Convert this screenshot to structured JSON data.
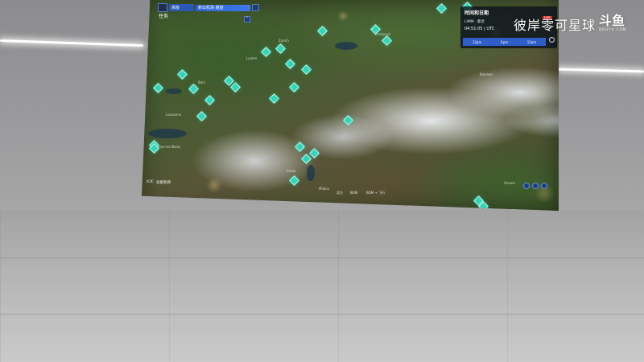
{
  "map": {
    "top_category": "高级",
    "top_bar_label": "新出机场 跑道",
    "mission_label": "任务",
    "chevron_glyph": "˅",
    "places": [
      {
        "name": "Zurich"
      },
      {
        "name": "Luzern"
      },
      {
        "name": "Bern"
      },
      {
        "name": "Lausanne"
      },
      {
        "name": "Thonon-les-Bains"
      },
      {
        "name": "Milano"
      },
      {
        "name": "Innsbruck"
      },
      {
        "name": "Bolzano"
      },
      {
        "name": "Como"
      },
      {
        "name": "Verona"
      }
    ],
    "bottom_left": {
      "code": "ICIC",
      "label": "逗留机场"
    },
    "bottom_labels": [
      "北方",
      "BGM",
      "BGM + 飞行"
    ],
    "pin_color": "#2fd6b8"
  },
  "time_panel": {
    "title": "时间和日期",
    "location": "LIMM · 都灵",
    "time": "04:51:05 | UTC",
    "live_badge": "LIVE",
    "ticks": [
      "12pm",
      "6pm",
      "12am"
    ]
  },
  "watermark": {
    "text": "彼岸零可星球",
    "logo": "斗鱼",
    "logo_sub": "DOUYU.COM"
  }
}
